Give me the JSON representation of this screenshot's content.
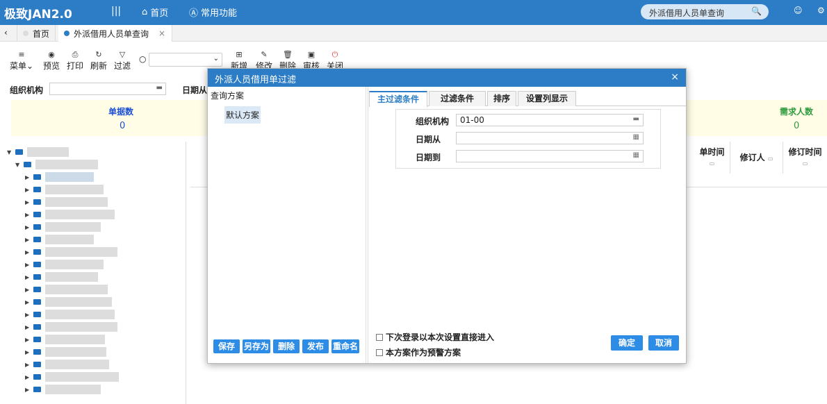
{
  "app": {
    "title": "极致JAN2.0",
    "menu_toggle": "|||",
    "nav_home": "首页",
    "nav_common": "常用功能",
    "search_value": "外派借用人员单查询"
  },
  "tabs": {
    "home": "首页",
    "active": "外派借用人员单查询",
    "close": "×",
    "back": "‹"
  },
  "toolbar": {
    "menu": "菜单",
    "preview": "预览",
    "print": "打印",
    "refresh": "刷新",
    "filter": "过滤",
    "new": "新增",
    "edit": "修改",
    "delete": "删除",
    "audit": "审核",
    "close": "关闭"
  },
  "filters": {
    "org_label": "组织机构",
    "date_from_label": "日期从"
  },
  "cards": {
    "doc_count_label": "单据数",
    "doc_count_value": "0",
    "demand_label": "需求人数",
    "demand_value": "0"
  },
  "grid": {
    "col_doc_time": "单时间",
    "col_reviser": "修订人",
    "col_revise_time": "修订时间"
  },
  "dialog": {
    "title": "外派人员借用单过滤",
    "close": "×",
    "scheme_label": "查询方案",
    "scheme_default": "默认方案",
    "tabs": [
      "主过滤条件",
      "过滤条件",
      "排序",
      "设置列显示"
    ],
    "org_label": "组织机构",
    "org_value": "01-00",
    "date_from_label": "日期从",
    "date_to_label": "日期到",
    "buttons_left": [
      "保存",
      "另存为",
      "删除",
      "发布",
      "重命名"
    ],
    "check_direct": "下次登录以本次设置直接进入",
    "check_warning": "本方案作为预警方案",
    "ok": "确定",
    "cancel": "取消"
  },
  "colors": {
    "brand": "#2c7dc6",
    "card_bg": "#fffde6",
    "doc_count": "#1a4fd6",
    "demand": "#2e9b3e"
  }
}
